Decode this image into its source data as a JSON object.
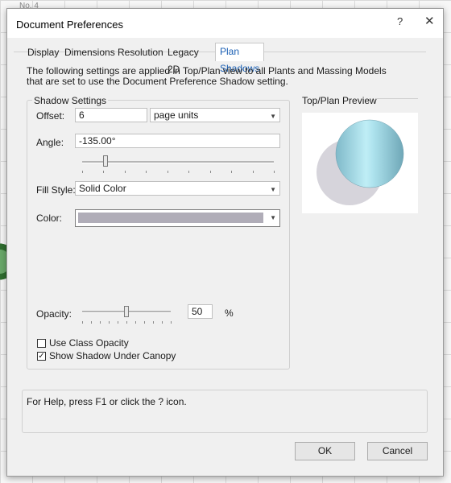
{
  "background": {
    "label": "No. 4"
  },
  "dialog": {
    "title": "Document Preferences",
    "help_glyph": "?",
    "close_glyph": "✕"
  },
  "tabs": [
    {
      "label": "Display"
    },
    {
      "label": "Dimensions"
    },
    {
      "label": "Resolution"
    },
    {
      "label": "Legacy 2D"
    },
    {
      "label": "Plan Shadows",
      "active": true
    }
  ],
  "intro": "The following settings are applied in Top/Plan view to all Plants and Massing Models that are set to use the Document Preference Shadow setting.",
  "shadow": {
    "group_title": "Shadow Settings",
    "offset_label": "Offset:",
    "offset_value": "6",
    "units_value": "page units",
    "angle_label": "Angle:",
    "angle_value": "-135.00°",
    "angle_slider_fraction": 0.12,
    "fill_style_label": "Fill Style:",
    "fill_style_value": "Solid Color",
    "color_label": "Color:",
    "color_value": "#b0adb8",
    "opacity_label": "Opacity:",
    "opacity_value": "50",
    "opacity_unit": "%",
    "opacity_slider_fraction": 0.5,
    "use_class_opacity_label": "Use Class Opacity",
    "use_class_opacity_checked": false,
    "show_under_canopy_label": "Show Shadow Under Canopy",
    "show_under_canopy_checked": true
  },
  "preview": {
    "title": "Top/Plan Preview",
    "shadow_color": "#d6d4db",
    "object_color": "#8cc6d4"
  },
  "help_text": "For Help, press F1 or click the ? icon.",
  "buttons": {
    "ok": "OK",
    "cancel": "Cancel"
  }
}
